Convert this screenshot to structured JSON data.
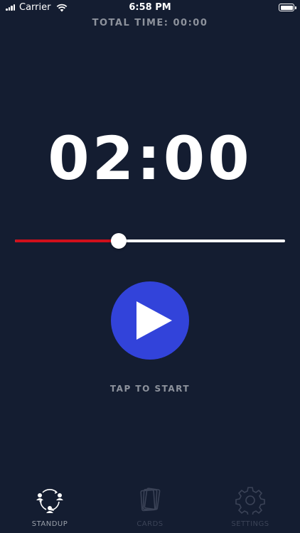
{
  "status_bar": {
    "carrier": "Carrier",
    "time": "6:58 PM"
  },
  "header": {
    "total_time_label": "TOTAL TIME: 00:00"
  },
  "timer": {
    "display": "02:00"
  },
  "slider": {
    "value_fraction": 0.385,
    "fill_color": "#d0101b",
    "track_color": "#ffffff"
  },
  "play": {
    "icon": "play-icon",
    "color": "#3243da"
  },
  "hint": {
    "label": "TAP TO START"
  },
  "tab_bar": {
    "tabs": [
      {
        "label": "STANDUP",
        "icon": "team-cycle-icon",
        "active": true
      },
      {
        "label": "CARDS",
        "icon": "cards-icon",
        "active": false
      },
      {
        "label": "SETTINGS",
        "icon": "gear-icon",
        "active": false
      }
    ]
  },
  "colors": {
    "background": "#141d31",
    "muted_text": "#8d929c"
  }
}
